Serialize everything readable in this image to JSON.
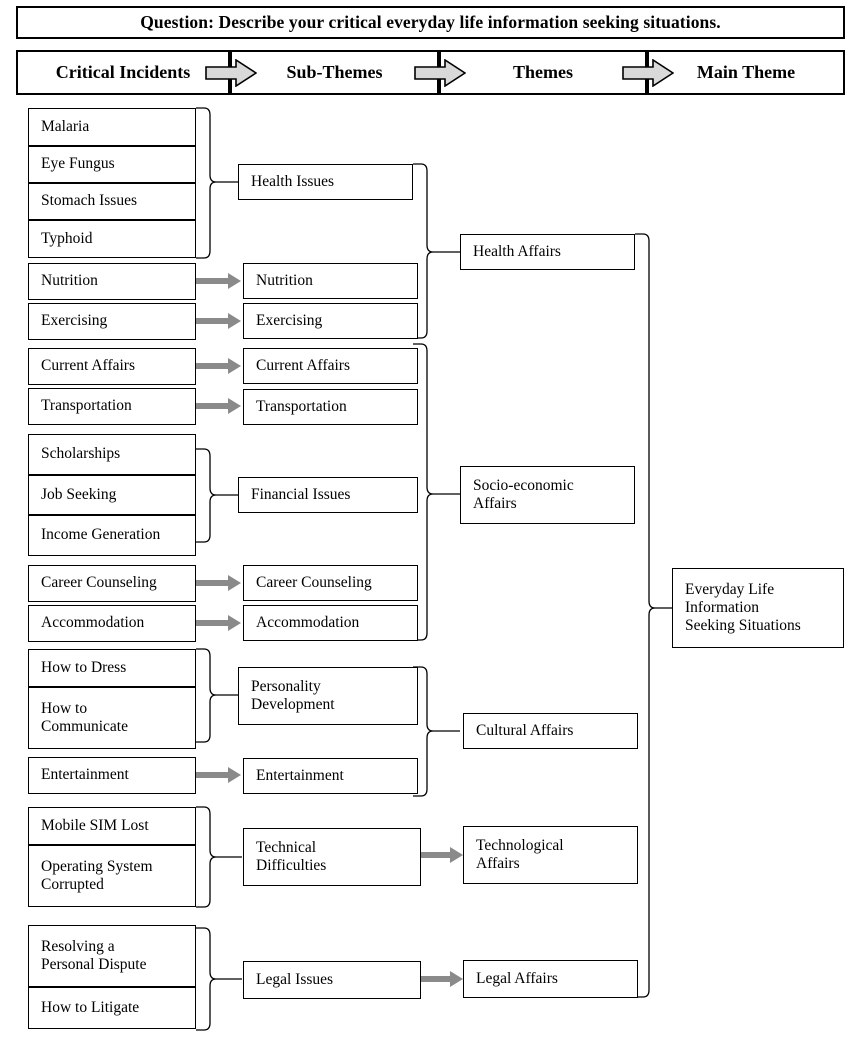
{
  "question": {
    "text": "Question: Describe your critical everyday life information seeking situations."
  },
  "columns": {
    "headers": [
      {
        "label": "Critical Incidents"
      },
      {
        "label": "Sub-Themes"
      },
      {
        "label": "Themes"
      },
      {
        "label": "Main Theme"
      }
    ],
    "arrow_icon": "block-arrow-right-icon"
  },
  "critical_incidents": [
    {
      "label": "Malaria"
    },
    {
      "label": "Eye Fungus"
    },
    {
      "label": "Stomach Issues"
    },
    {
      "label": "Typhoid"
    },
    {
      "label": "Nutrition"
    },
    {
      "label": "Exercising"
    },
    {
      "label": "Current Affairs"
    },
    {
      "label": "Transportation"
    },
    {
      "label": "Scholarships"
    },
    {
      "label": "Job Seeking"
    },
    {
      "label": "Income Generation"
    },
    {
      "label": "Career Counseling"
    },
    {
      "label": "Accommodation"
    },
    {
      "label": "How to Dress"
    },
    {
      "label": "How to\nCommunicate"
    },
    {
      "label": "Entertainment"
    },
    {
      "label": "Mobile SIM Lost"
    },
    {
      "label": "Operating System\nCorrupted"
    },
    {
      "label": "Resolving a\nPersonal Dispute"
    },
    {
      "label": "How to Litigate"
    }
  ],
  "sub_themes": [
    {
      "label": "Health Issues"
    },
    {
      "label": "Nutrition"
    },
    {
      "label": "Exercising"
    },
    {
      "label": "Current Affairs"
    },
    {
      "label": "Transportation"
    },
    {
      "label": "Financial Issues"
    },
    {
      "label": "Career Counseling"
    },
    {
      "label": "Accommodation"
    },
    {
      "label": "Personality\nDevelopment"
    },
    {
      "label": "Entertainment"
    },
    {
      "label": "Technical\nDifficulties"
    },
    {
      "label": "Legal Issues"
    }
  ],
  "themes": [
    {
      "label": "Health Affairs"
    },
    {
      "label": "Socio-economic\nAffairs"
    },
    {
      "label": "Cultural Affairs"
    },
    {
      "label": "Technological\nAffairs"
    },
    {
      "label": "Legal Affairs"
    }
  ],
  "main_theme": {
    "label": "Everyday Life\nInformation\nSeeking Situations"
  },
  "colors": {
    "line": "#000000",
    "arrow_gray": "#8a8a8a",
    "header_arrow_fill": "#d9d9d9",
    "background": "#ffffff"
  }
}
